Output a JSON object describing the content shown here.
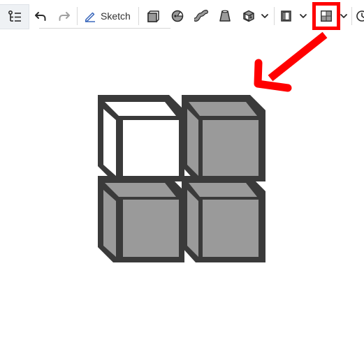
{
  "toolbar": {
    "sketch_label": "Sketch",
    "icons": [
      "feature-tree-icon",
      "undo-icon",
      "redo-icon",
      "sketch-pencil-icon",
      "extrude-icon",
      "revolve-icon",
      "sweep-icon",
      "loft-icon",
      "shell-icon",
      "chevron-down-icon",
      "plane-icon",
      "chevron-down-icon",
      "view-grid-icon",
      "chevron-down-icon",
      "clock-icon"
    ]
  },
  "callout": {
    "highlight_color": "#ff0000",
    "target": "view-grid-icon"
  },
  "hero_icon": {
    "name": "view-grid-enlarged",
    "highlighted_cell_color": "#ffffff",
    "cell_color": "#9a9a9a",
    "outline_color": "#3a3a3a"
  }
}
